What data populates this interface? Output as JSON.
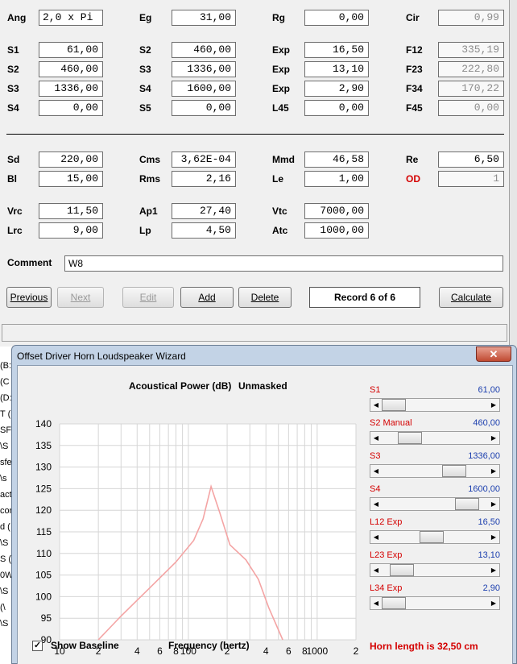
{
  "form": {
    "row1": [
      {
        "label": "Ang",
        "value": "2,0 x Pi"
      },
      {
        "label": "Eg",
        "value": "31,00"
      },
      {
        "label": "Rg",
        "value": "0,00"
      },
      {
        "label": "Cir",
        "value": "0,99"
      }
    ],
    "row2": [
      {
        "label": "S1",
        "value": "61,00"
      },
      {
        "label": "S2",
        "value": "460,00"
      },
      {
        "label": "Exp",
        "value": "16,50"
      },
      {
        "label": "F12",
        "value": "335,19"
      }
    ],
    "row3": [
      {
        "label": "S2",
        "value": "460,00"
      },
      {
        "label": "S3",
        "value": "1336,00"
      },
      {
        "label": "Exp",
        "value": "13,10"
      },
      {
        "label": "F23",
        "value": "222,80"
      }
    ],
    "row4": [
      {
        "label": "S3",
        "value": "1336,00"
      },
      {
        "label": "S4",
        "value": "1600,00"
      },
      {
        "label": "Exp",
        "value": "2,90"
      },
      {
        "label": "F34",
        "value": "170,22"
      }
    ],
    "row5": [
      {
        "label": "S4",
        "value": "0,00"
      },
      {
        "label": "S5",
        "value": "0,00"
      },
      {
        "label": "L45",
        "value": "0,00"
      },
      {
        "label": "F45",
        "value": "0,00"
      }
    ],
    "row6": [
      {
        "label": "Sd",
        "value": "220,00"
      },
      {
        "label": "Cms",
        "value": "3,62E-04"
      },
      {
        "label": "Mmd",
        "value": "46,58"
      },
      {
        "label": "Re",
        "value": "6,50"
      }
    ],
    "row7": [
      {
        "label": "Bl",
        "value": "15,00"
      },
      {
        "label": "Rms",
        "value": "2,16"
      },
      {
        "label": "Le",
        "value": "1,00"
      },
      {
        "label": "OD",
        "value": "1"
      }
    ],
    "row8": [
      {
        "label": "Vrc",
        "value": "11,50"
      },
      {
        "label": "Ap1",
        "value": "27,40"
      },
      {
        "label": "Vtc",
        "value": "7000,00"
      }
    ],
    "row9": [
      {
        "label": "Lrc",
        "value": "9,00"
      },
      {
        "label": "Lp",
        "value": "4,50"
      },
      {
        "label": "Atc",
        "value": "1000,00"
      }
    ],
    "comment_label": "Comment",
    "comment_value": "W8"
  },
  "buttons": {
    "previous": "Previous",
    "next": "Next",
    "edit": "Edit",
    "add": "Add",
    "delete": "Delete",
    "record": "Record 6 of 6",
    "calculate": "Calculate"
  },
  "background_fragments": [
    "(B:",
    "(C",
    "(D:",
    "T (",
    "SF",
    "\\S",
    "sfe",
    "\\s",
    "act",
    "cor",
    "d (",
    "\\S",
    "S (",
    "0W",
    "\\S",
    "(\\",
    "\\S"
  ],
  "wizard": {
    "title": "Offset Driver Horn Loudspeaker Wizard",
    "close": "✕",
    "chart_title": "Acoustical Power (dB)",
    "chart_subtitle": "Unmasked",
    "show_baseline_label": "Show Baseline",
    "show_baseline_checked": true,
    "horn_length": "Horn length is 32,50 cm",
    "sliders": [
      {
        "name": "S1",
        "value": "61,00",
        "position": 0.0
      },
      {
        "name": "S2  Manual",
        "value": "460,00",
        "position": 0.2
      },
      {
        "name": "S3",
        "value": "1336,00",
        "position": 0.74
      },
      {
        "name": "S4",
        "value": "1600,00",
        "position": 0.89
      },
      {
        "name": "L12  Exp",
        "value": "16,50",
        "position": 0.46
      },
      {
        "name": "L23  Exp",
        "value": "13,10",
        "position": 0.1
      },
      {
        "name": "L34  Exp",
        "value": "2,90",
        "position": 0.0
      }
    ]
  },
  "chart_data": {
    "type": "line",
    "title": "Acoustical Power (dB)",
    "subtitle": "Unmasked",
    "xlabel": "Frequency (hertz)",
    "ylabel": "",
    "xscale": "log",
    "xlim": [
      10,
      2000
    ],
    "ylim": [
      90,
      140
    ],
    "x_tick_labels": [
      "10",
      "2",
      "4",
      "6",
      "8",
      "100",
      "2",
      "4",
      "6",
      "8",
      "1000",
      "2"
    ],
    "y_ticks": [
      90,
      95,
      100,
      105,
      110,
      115,
      120,
      125,
      130,
      135,
      140
    ],
    "grid": true,
    "line_color": "#f4a4a4",
    "series": [
      {
        "x": [
          20,
          30,
          50,
          80,
          110,
          130,
          150,
          175,
          210,
          280,
          350,
          420,
          540
        ],
        "y": [
          90,
          95.5,
          102,
          108,
          113,
          118,
          125.5,
          119.5,
          112,
          108.5,
          104,
          97.5,
          90
        ]
      }
    ]
  }
}
